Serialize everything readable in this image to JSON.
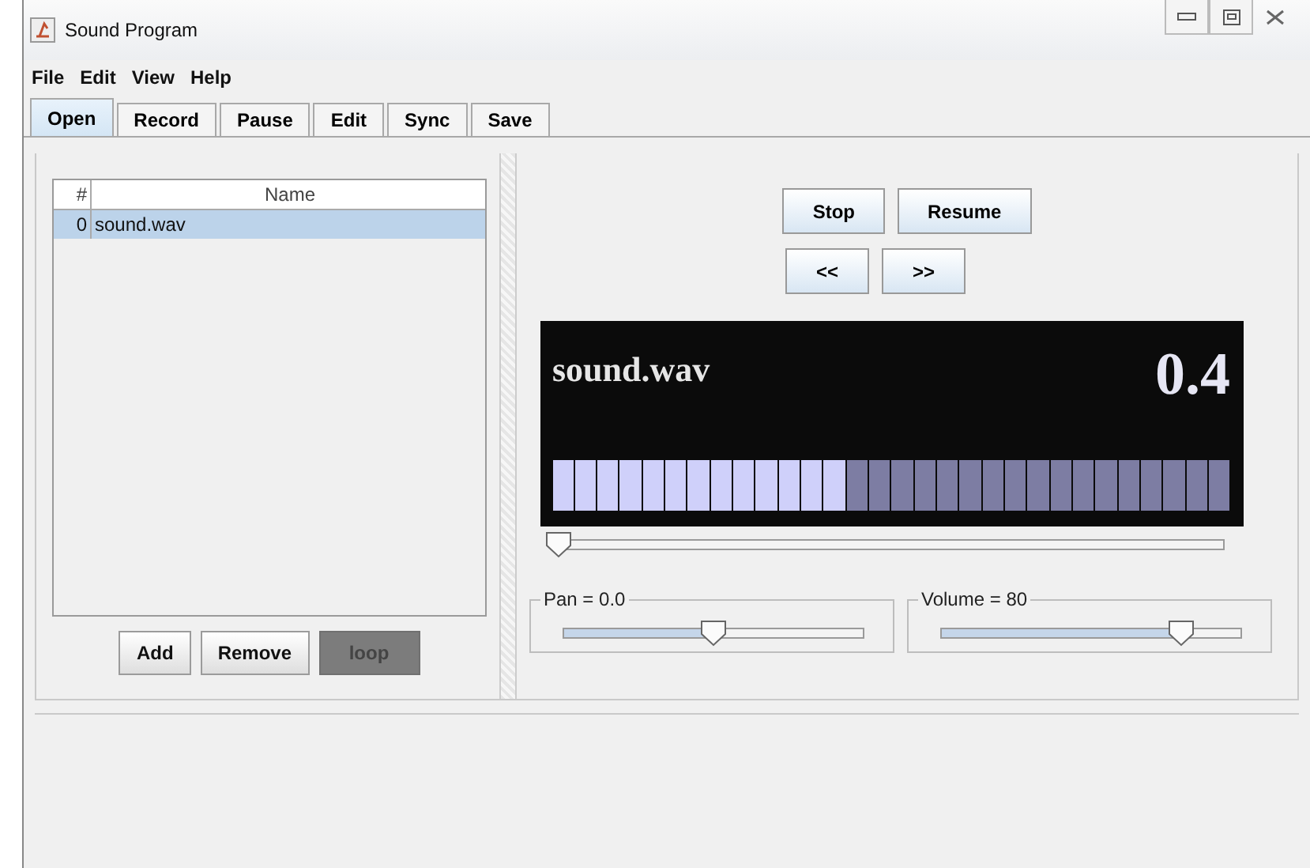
{
  "window": {
    "title": "Sound Program"
  },
  "menu": [
    "File",
    "Edit",
    "View",
    "Help"
  ],
  "tabs": [
    {
      "label": "Open",
      "selected": true
    },
    {
      "label": "Record",
      "selected": false
    },
    {
      "label": "Pause",
      "selected": false
    },
    {
      "label": "Edit",
      "selected": false
    },
    {
      "label": "Sync",
      "selected": false
    },
    {
      "label": "Save",
      "selected": false
    }
  ],
  "playlist": {
    "columns": [
      "#",
      "Name"
    ],
    "rows": [
      {
        "index": "0",
        "name": "sound.wav",
        "selected": true
      }
    ]
  },
  "playlist_buttons": [
    {
      "label": "Add",
      "on": false
    },
    {
      "label": "Remove",
      "on": false
    },
    {
      "label": "loop",
      "on": true
    }
  ],
  "transport_buttons": [
    "Stop",
    "Resume"
  ],
  "seek_buttons": [
    "<<",
    ">>"
  ],
  "display": {
    "file": "sound.wav",
    "reading": "0.4",
    "level": 0.433
  },
  "position": {
    "level": 0.0
  },
  "pan": {
    "label": "Pan = 0.0",
    "level": 0.5
  },
  "volume": {
    "label": "Volume = 80",
    "level": 0.8
  }
}
